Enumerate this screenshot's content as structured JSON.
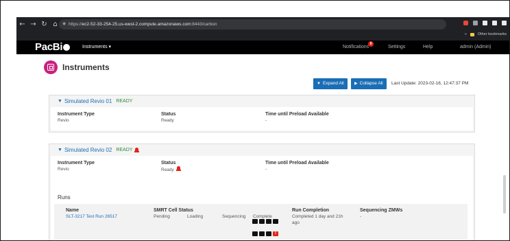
{
  "browser": {
    "url_prefix": "https://",
    "url_host": "ec2-52-33-254-25.us-west-2.compute.amazonaws.com",
    "url_path": ":8443/carbon",
    "other_bookmarks": "Other bookmarks"
  },
  "navbar": {
    "logo": "PacBi",
    "instruments_menu": "Instruments ▾",
    "notifications": "Notifications",
    "notifications_count": "6",
    "settings": "Settings",
    "help": "Help",
    "user": "admin (Admin)"
  },
  "page": {
    "title": "Instruments",
    "expand_all": "Expand All",
    "collapse_all": "Collapse All",
    "last_update": "Last Update: 2023-02-16, 12:47:37 PM"
  },
  "instruments": [
    {
      "name": "Simulated Revio 01",
      "status_tag": "READY",
      "instrument_type_label": "Instrument Type",
      "instrument_type": "Revio",
      "status_label": "Status",
      "status": "Ready",
      "preload_label": "Time until Preload Available",
      "preload": "-"
    },
    {
      "name": "Simulated Revio 02",
      "status_tag": "READY",
      "instrument_type_label": "Instrument Type",
      "instrument_type": "Revio",
      "status_label": "Status",
      "status": "Ready",
      "preload_label": "Time until Preload Available",
      "preload": "-",
      "runs_title": "Runs",
      "runs": [
        {
          "name_label": "Name",
          "name": "SLT-3217 Test Run 26517",
          "smrt_label": "SMRT Cell Status",
          "smrt_pending": "Pending",
          "smrt_loading": "Loading",
          "smrt_sequencing": "Sequencing",
          "smrt_complete": "Complete",
          "completion_label": "Run Completion",
          "completion": "Completed 1 day and 21h ago",
          "zmw_label": "Sequencing ZMWs",
          "zmw": "-",
          "cell_error_mark": "!"
        }
      ]
    }
  ],
  "colors": {
    "accent": "#1a6eb5",
    "ready": "#2e8b3a",
    "alert": "#e2231a",
    "brand_icon": "#c8217f"
  }
}
